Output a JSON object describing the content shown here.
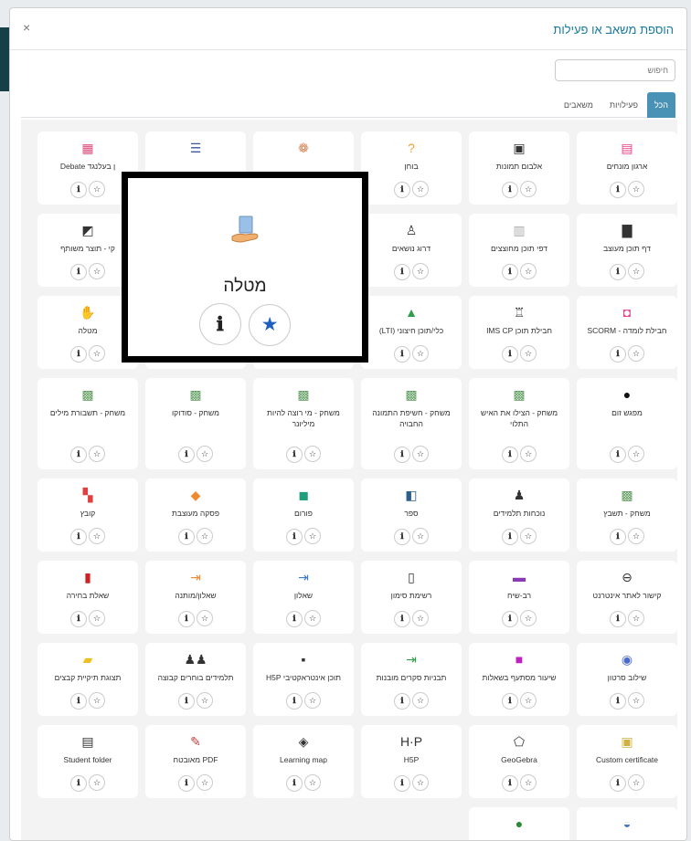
{
  "dialog": {
    "title": "הוספת משאב או פעילות",
    "close_glyph": "×",
    "search_placeholder": "חיפוש"
  },
  "tabs": [
    {
      "label": "הכל",
      "active": true
    },
    {
      "label": "פעילויות",
      "active": false
    },
    {
      "label": "משאבים",
      "active": false
    }
  ],
  "card_buttons": {
    "info_glyph": "ℹ",
    "star_glyph": "☆"
  },
  "popup": {
    "title": "מטלה",
    "icon": "assignment-hand-icon",
    "info_glyph": "ℹ",
    "star_glyph": "★"
  },
  "cards": [
    {
      "label": "ארגון מונחים",
      "glyph": "▤",
      "color": "#e83e8c",
      "icon": "glossary-icon"
    },
    {
      "label": "אלבום תמונות",
      "glyph": "▣",
      "color": "#333333",
      "icon": "gallery-icon"
    },
    {
      "label": "בוחן",
      "glyph": "?",
      "color": "#f0a030",
      "icon": "quiz-icon"
    },
    {
      "label": "",
      "glyph": "❁",
      "color": "#d08050",
      "icon": "feedback-icon"
    },
    {
      "label": "",
      "glyph": "☰",
      "color": "#3a5a98",
      "icon": "list-icon"
    },
    {
      "label": "ן בעלנגד Debate",
      "glyph": "▦",
      "color": "#d84a7a",
      "icon": "debate-icon"
    },
    {
      "label": "דף תוכן מעוצב",
      "glyph": "▇",
      "color": "#333333",
      "icon": "page-icon"
    },
    {
      "label": "דפי תוכן מחוצצים",
      "glyph": "▥",
      "color": "#aaaaaa",
      "icon": "tabbed-page-icon"
    },
    {
      "label": "דרוג נושאים",
      "glyph": "♙",
      "color": "#333333",
      "icon": "rating-icon"
    },
    {
      "label": "",
      "glyph": "",
      "color": "#333333",
      "icon": "hidden-icon"
    },
    {
      "label": "",
      "glyph": "",
      "color": "#333333",
      "icon": "hidden-icon"
    },
    {
      "label": "קי - תוצר משותף",
      "glyph": "◩",
      "color": "#333333",
      "icon": "wiki-icon"
    },
    {
      "label": "חבילת לומדה - SCORM",
      "glyph": "◘",
      "color": "#e83e8c",
      "icon": "scorm-icon"
    },
    {
      "label": "חבילת תוכן IMS CP",
      "glyph": "♖",
      "color": "#333333",
      "icon": "ims-icon"
    },
    {
      "label": "כלי/תוכן חיצוני (LTI)",
      "glyph": "▲",
      "color": "#2e9e4a",
      "icon": "lti-icon"
    },
    {
      "label": "",
      "glyph": "",
      "color": "#333333",
      "icon": "hidden-icon"
    },
    {
      "label": "",
      "glyph": "",
      "color": "#333333",
      "icon": "hidden-icon"
    },
    {
      "label": "מטלה",
      "glyph": "✋",
      "color": "#5a8ac0",
      "icon": "assignment-icon"
    },
    {
      "label": "מפגש זום",
      "glyph": "●",
      "color": "#111111",
      "icon": "zoom-icon"
    },
    {
      "label": "משחק - הצילו את האיש התלוי",
      "glyph": "▩",
      "color": "#5a9a5a",
      "icon": "hangman-icon"
    },
    {
      "label": "משחק - חשיפת התמונה החבויה",
      "glyph": "▩",
      "color": "#5a9a5a",
      "icon": "hidden-picture-icon"
    },
    {
      "label": "משחק - מי רוצה להיות מיליונר",
      "glyph": "▩",
      "color": "#5a9a5a",
      "icon": "millionaire-icon"
    },
    {
      "label": "משחק - סודוקו",
      "glyph": "▩",
      "color": "#5a9a5a",
      "icon": "sudoku-icon"
    },
    {
      "label": "משחק - תשבורת מילים",
      "glyph": "▩",
      "color": "#5a9a5a",
      "icon": "crossword-icon"
    },
    {
      "label": "משחק - תשבץ",
      "glyph": "▩",
      "color": "#5a9a5a",
      "icon": "puzzle-icon"
    },
    {
      "label": "נוכחות תלמידים",
      "glyph": "♟",
      "color": "#333333",
      "icon": "attendance-icon"
    },
    {
      "label": "ספר",
      "glyph": "◧",
      "color": "#2d5f8a",
      "icon": "book-icon"
    },
    {
      "label": "פורום",
      "glyph": "◼",
      "color": "#1e9e7a",
      "icon": "forum-icon"
    },
    {
      "label": "פסקה מעוצבת",
      "glyph": "◆",
      "color": "#f08a30",
      "icon": "label-icon"
    },
    {
      "label": "קובץ",
      "glyph": "▚",
      "color": "#e04040",
      "icon": "file-icon"
    },
    {
      "label": "קישור לאתר אינטרנט",
      "glyph": "⊖",
      "color": "#333333",
      "icon": "url-icon"
    },
    {
      "label": "רב-שיח",
      "glyph": "▬",
      "color": "#8a3ab5",
      "icon": "chat-icon"
    },
    {
      "label": "רשימת סימון",
      "glyph": "▯",
      "color": "#333333",
      "icon": "checklist-icon"
    },
    {
      "label": "שאלון",
      "glyph": "⇥",
      "color": "#3a7acf",
      "icon": "questionnaire-icon"
    },
    {
      "label": "שאלון/מותנה",
      "glyph": "⇥",
      "color": "#f08a30",
      "icon": "lesson-icon"
    },
    {
      "label": "שאלת בחירה",
      "glyph": "▮",
      "color": "#d02020",
      "icon": "choice-icon"
    },
    {
      "label": "שילוב סרטון",
      "glyph": "◉",
      "color": "#4a6ad0",
      "icon": "video-icon"
    },
    {
      "label": "שיעור מסתעף בשאלות",
      "glyph": "■",
      "color": "#c020c0",
      "icon": "branching-lesson-icon"
    },
    {
      "label": "תבניות סקרים מובנות",
      "glyph": "⇥",
      "color": "#2e9e4a",
      "icon": "survey-icon"
    },
    {
      "label": "תוכן אינטראקטיבי H5P",
      "glyph": "▪",
      "color": "#333333",
      "icon": "h5p-interactive-icon"
    },
    {
      "label": "תלמידים בוחרים קבוצה",
      "glyph": "♟♟",
      "color": "#333333",
      "icon": "group-choice-icon"
    },
    {
      "label": "תצוגת תיקיית קבצים",
      "glyph": "▰",
      "color": "#f0c020",
      "icon": "folder-icon"
    },
    {
      "label": "Custom certificate",
      "glyph": "▣",
      "color": "#d0b040",
      "icon": "certificate-icon"
    },
    {
      "label": "GeoGebra",
      "glyph": "⬠",
      "color": "#333333",
      "icon": "geogebra-icon"
    },
    {
      "label": "H5P",
      "glyph": "H·P",
      "color": "#333333",
      "icon": "h5p-icon"
    },
    {
      "label": "Learning map",
      "glyph": "◈",
      "color": "#333333",
      "icon": "learning-map-icon"
    },
    {
      "label": "PDF מאובטח",
      "glyph": "✎",
      "color": "#c04040",
      "icon": "secure-pdf-icon"
    },
    {
      "label": "Student folder",
      "glyph": "▤",
      "color": "#333333",
      "icon": "student-folder-icon"
    },
    {
      "label": "",
      "glyph": "◒",
      "color": "#4a7ac0",
      "icon": "hotpot-icon"
    },
    {
      "label": "",
      "glyph": "●",
      "color": "#2a8a3a",
      "icon": "globe-icon"
    }
  ]
}
